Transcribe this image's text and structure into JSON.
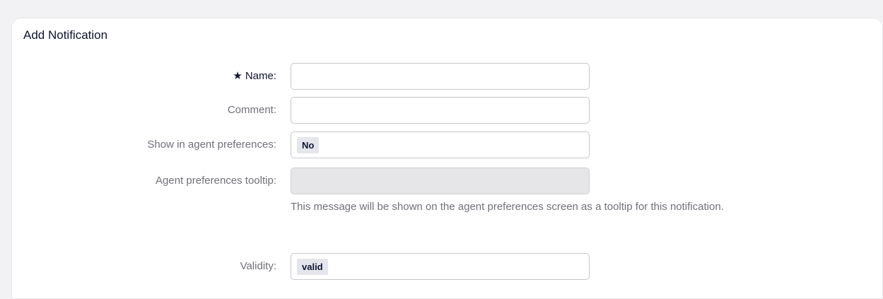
{
  "panel": {
    "title": "Add Notification"
  },
  "form": {
    "name": {
      "label": "Name:",
      "value": "",
      "required": true
    },
    "comment": {
      "label": "Comment:",
      "value": ""
    },
    "show_in_prefs": {
      "label": "Show in agent preferences:",
      "selected": "No"
    },
    "prefs_tooltip": {
      "label": "Agent preferences tooltip:",
      "value": "",
      "disabled": true
    },
    "help_text": "This message will be shown on the agent preferences screen as a tooltip for this notification.",
    "validity": {
      "label": "Validity:",
      "selected": "valid"
    }
  },
  "colors": {
    "background": "#f2f2f4",
    "panel": "#ffffff",
    "label": "#707079",
    "title": "#0f1530",
    "chip_bg": "#e5e6ec"
  }
}
